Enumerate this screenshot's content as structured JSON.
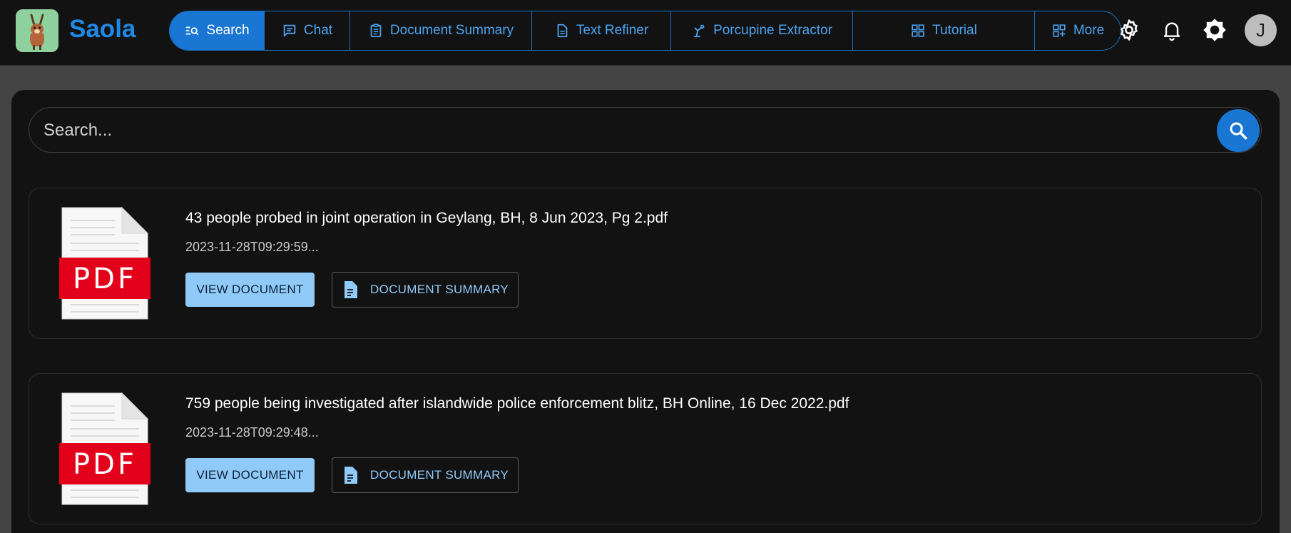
{
  "app": {
    "brand": "Saola"
  },
  "nav": {
    "items": [
      {
        "label": "Search",
        "icon": "manage-search-icon",
        "active": true
      },
      {
        "label": "Chat",
        "icon": "chat-icon"
      },
      {
        "label": "Document Summary",
        "icon": "clipboard-icon"
      },
      {
        "label": "Text Refiner",
        "icon": "document-icon"
      },
      {
        "label": "Porcupine Extractor",
        "icon": "extractor-icon"
      },
      {
        "label": "Tutorial",
        "icon": "grid-icon"
      },
      {
        "label": "More",
        "icon": "grid-plus-icon"
      }
    ]
  },
  "header_icons": [
    "gear-icon",
    "bell-icon",
    "brightness-icon"
  ],
  "user": {
    "initial": "J"
  },
  "search": {
    "placeholder": "Search..."
  },
  "results": [
    {
      "title": "43 people probed in joint operation in Geylang, BH, 8 Jun 2023, Pg 2.pdf",
      "date": "2023-11-28T09:29:59...",
      "view_label": "VIEW DOCUMENT",
      "summary_label": "DOCUMENT SUMMARY",
      "badge": "PDF"
    },
    {
      "title": "759 people being investigated after islandwide police enforcement blitz, BH Online, 16 Dec 2022.pdf",
      "date": "2023-11-28T09:29:48...",
      "view_label": "VIEW DOCUMENT",
      "summary_label": "DOCUMENT SUMMARY",
      "badge": "PDF"
    }
  ],
  "colors": {
    "accent": "#1976d2",
    "button_light": "#90caf9",
    "pdf_red": "#e3001b",
    "background": "#121212"
  }
}
